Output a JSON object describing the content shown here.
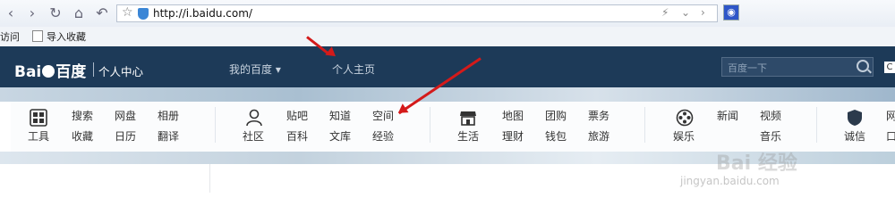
{
  "browser": {
    "url": "http://i.baidu.com/",
    "bookmarks": [
      "访问",
      "导入收藏"
    ]
  },
  "header": {
    "logo_text": "Bai",
    "logo_text2": "百度",
    "logo_sub": "个人中心",
    "nav": [
      "我的百度",
      "个人主页"
    ],
    "search_placeholder": "百度一下"
  },
  "menu": {
    "group1": {
      "label": "工具",
      "items": [
        "搜索",
        "网盘",
        "相册",
        "收藏",
        "日历",
        "翻译"
      ]
    },
    "group2": {
      "label": "社区",
      "items": [
        "贴吧",
        "知道",
        "空间",
        "百科",
        "文库",
        "经验"
      ]
    },
    "group3": {
      "label": "生活",
      "items": [
        "地图",
        "团购",
        "票务",
        "理财",
        "钱包",
        "旅游"
      ]
    },
    "group4": {
      "label": "娱乐",
      "items": [
        "新闻",
        "视频",
        "音乐"
      ]
    },
    "group5": {
      "label": "诚信",
      "items": [
        "网",
        "口"
      ]
    }
  },
  "watermark": {
    "big": "Bai 经验",
    "url": "jingyan.baidu.com"
  },
  "colors": {
    "header_bg": "#1d3a58",
    "arrow": "#d41a1a"
  }
}
